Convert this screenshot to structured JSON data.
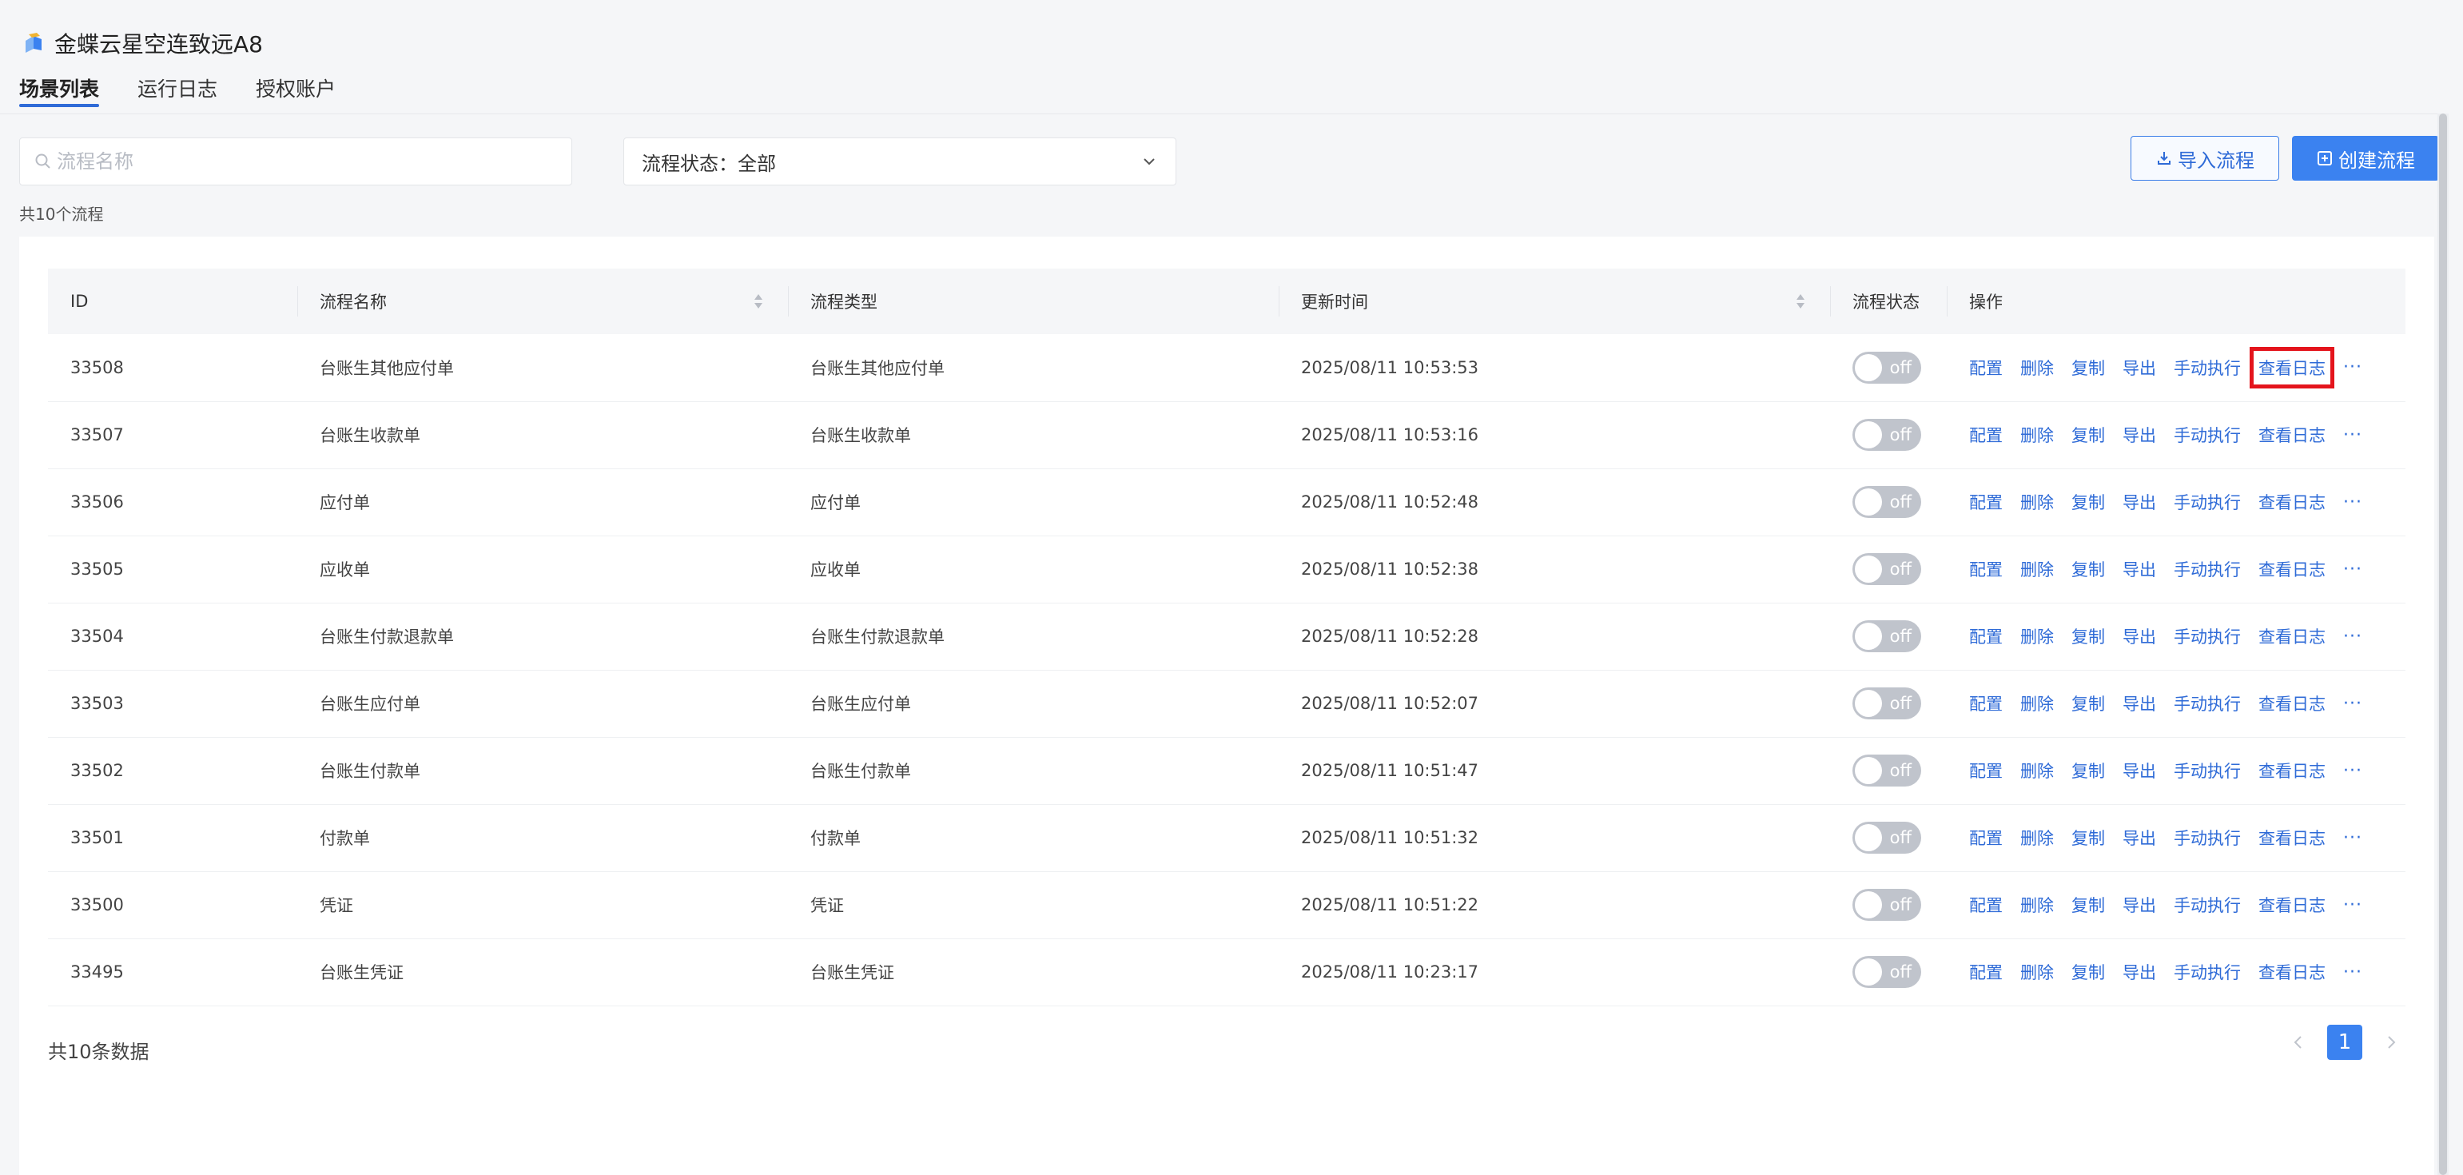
{
  "app": {
    "title": "金蝶云星空连致远A8"
  },
  "tabs": [
    {
      "label": "场景列表",
      "active": true
    },
    {
      "label": "运行日志",
      "active": false
    },
    {
      "label": "授权账户",
      "active": false
    }
  ],
  "filters": {
    "search_placeholder": "流程名称",
    "status_label": "流程状态：全部"
  },
  "toolbar": {
    "import_label": "导入流程",
    "create_label": "创建流程"
  },
  "summary": {
    "total_flows": "共10个流程"
  },
  "table": {
    "columns": [
      "ID",
      "流程名称",
      "流程类型",
      "更新时间",
      "流程状态",
      "操作"
    ],
    "actions": [
      "配置",
      "删除",
      "复制",
      "导出",
      "手动执行",
      "查看日志"
    ],
    "more": "···",
    "rows": [
      {
        "id": "33508",
        "name": "台账生其他应付单",
        "type": "台账生其他应付单",
        "updated": "2025/08/11 10:53:53",
        "status": "off"
      },
      {
        "id": "33507",
        "name": "台账生收款单",
        "type": "台账生收款单",
        "updated": "2025/08/11 10:53:16",
        "status": "off"
      },
      {
        "id": "33506",
        "name": "应付单",
        "type": "应付单",
        "updated": "2025/08/11 10:52:48",
        "status": "off"
      },
      {
        "id": "33505",
        "name": "应收单",
        "type": "应收单",
        "updated": "2025/08/11 10:52:38",
        "status": "off"
      },
      {
        "id": "33504",
        "name": "台账生付款退款单",
        "type": "台账生付款退款单",
        "updated": "2025/08/11 10:52:28",
        "status": "off"
      },
      {
        "id": "33503",
        "name": "台账生应付单",
        "type": "台账生应付单",
        "updated": "2025/08/11 10:52:07",
        "status": "off"
      },
      {
        "id": "33502",
        "name": "台账生付款单",
        "type": "台账生付款单",
        "updated": "2025/08/11 10:51:47",
        "status": "off"
      },
      {
        "id": "33501",
        "name": "付款单",
        "type": "付款单",
        "updated": "2025/08/11 10:51:32",
        "status": "off"
      },
      {
        "id": "33500",
        "name": "凭证",
        "type": "凭证",
        "updated": "2025/08/11 10:51:22",
        "status": "off"
      },
      {
        "id": "33495",
        "name": "台账生凭证",
        "type": "台账生凭证",
        "updated": "2025/08/11 10:23:17",
        "status": "off"
      }
    ]
  },
  "footer": {
    "total_records": "共10条数据",
    "current_page": "1"
  },
  "colors": {
    "accent": "#3b82f0",
    "link": "#2f6bd7",
    "highlight": "#e4141c",
    "toggle_off": "#c0c4cc"
  }
}
